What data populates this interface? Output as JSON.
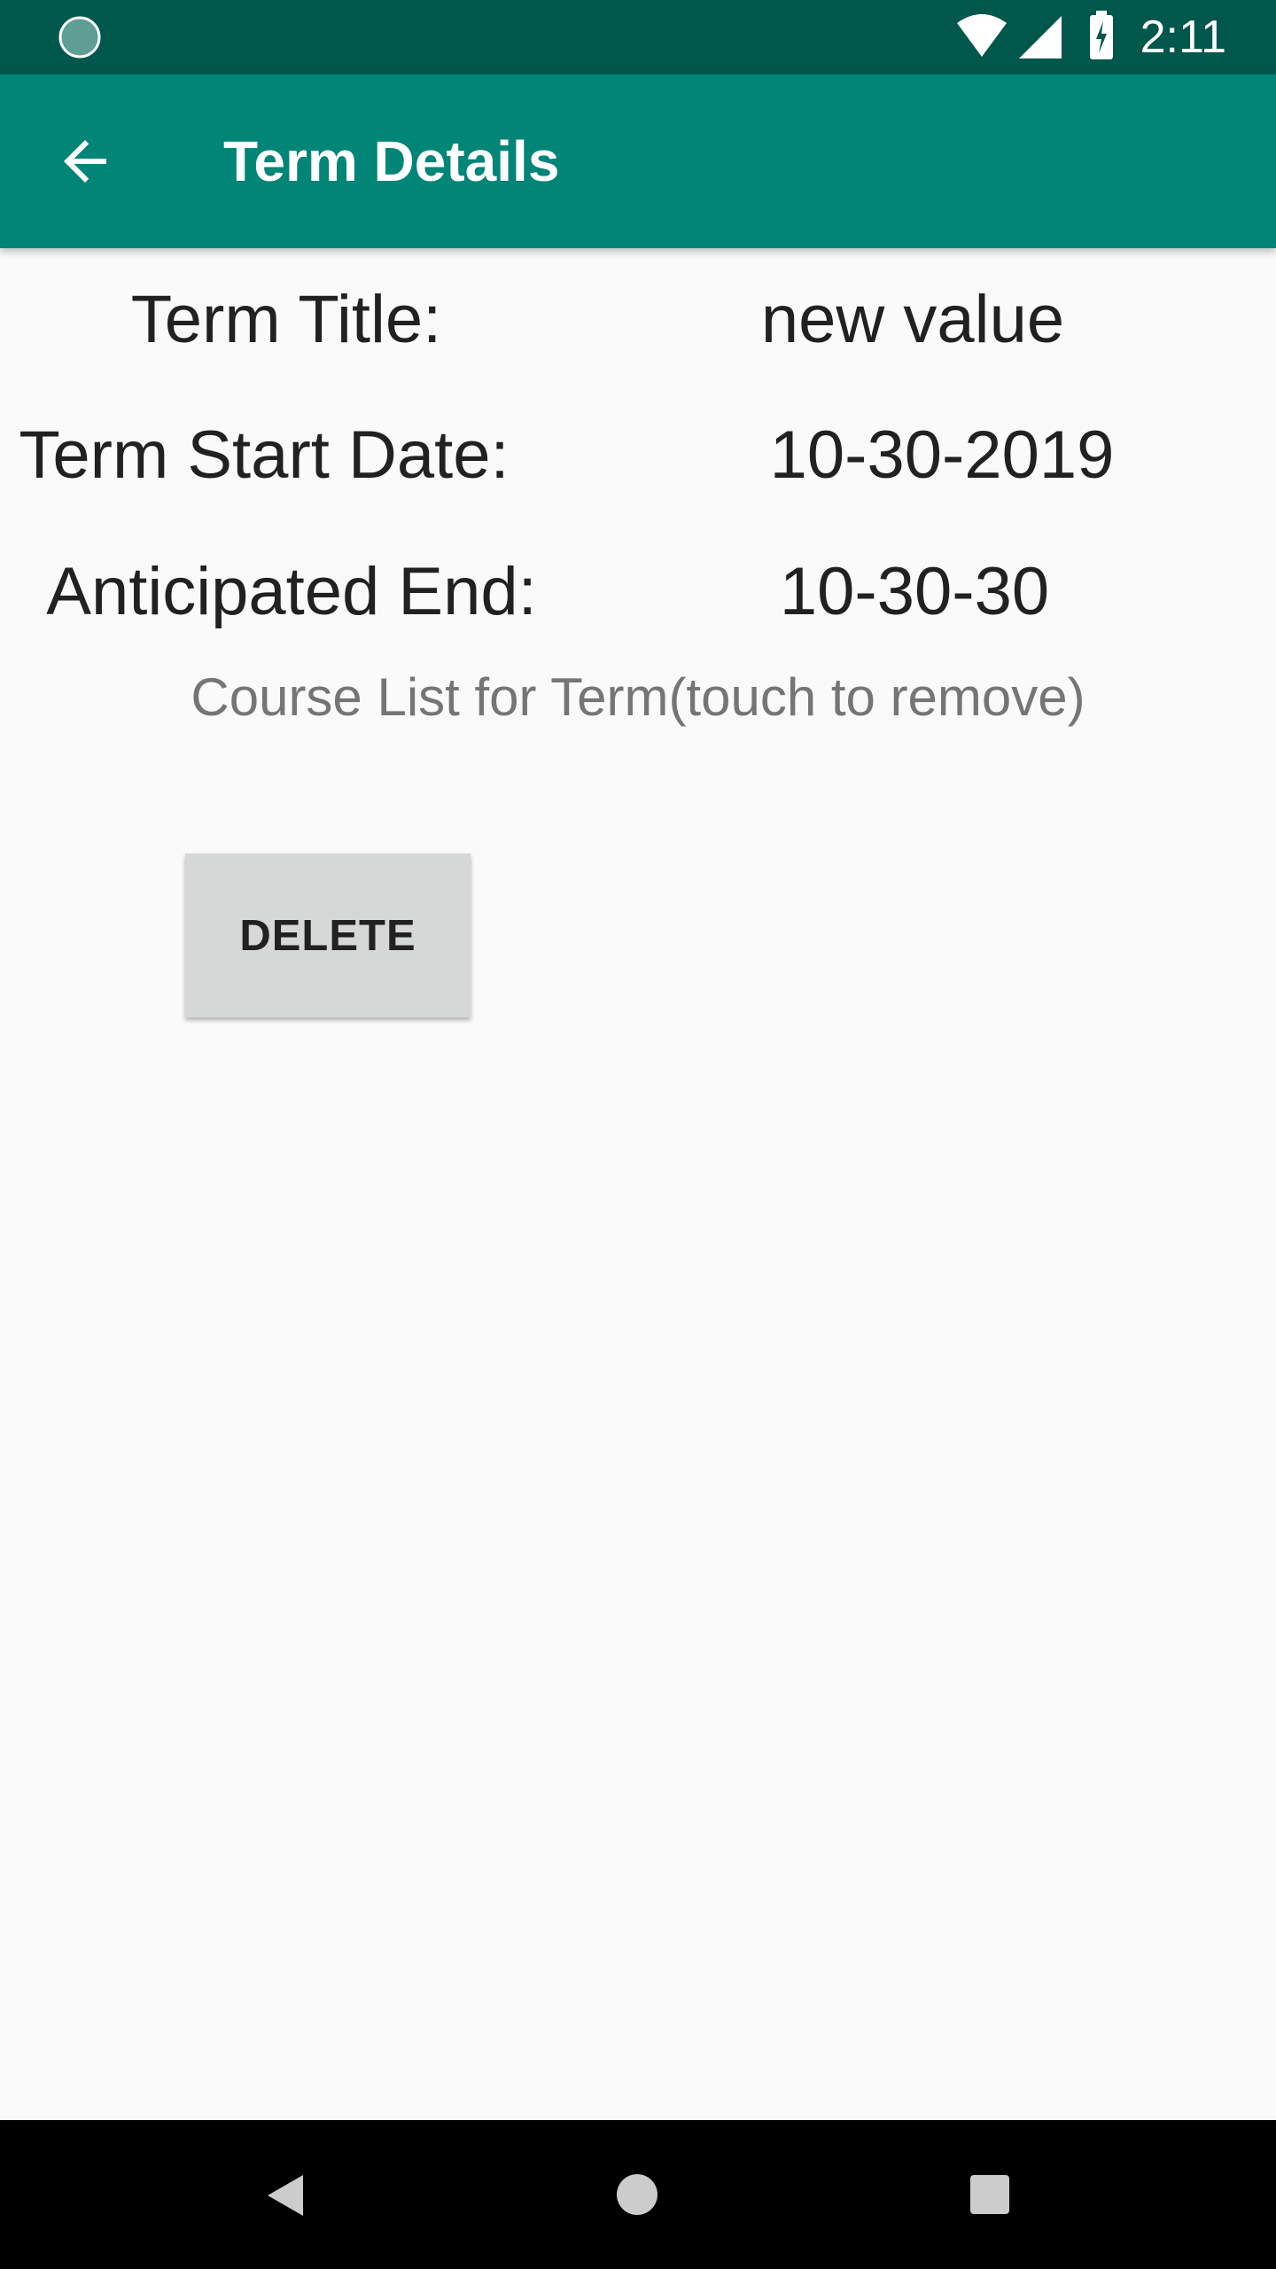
{
  "status_bar": {
    "time": "2:11",
    "icons": [
      "sync-icon",
      "wifi-icon",
      "signal-icon",
      "battery-charging-icon"
    ]
  },
  "toolbar": {
    "title": "Term Details",
    "back_icon": "arrow-back-icon"
  },
  "details": {
    "term_title_label": "Term Title:",
    "term_title_value": "new value",
    "start_date_label": "Term Start Date:",
    "start_date_value": "10-30-2019",
    "end_label": "Anticipated End:",
    "end_value": "10-30-30"
  },
  "course_list_label": "Course List for Term(touch to remove)",
  "delete_button": "DELETE",
  "colors": {
    "primary": "#008577",
    "primary_dark": "#00574b",
    "background": "#fafafa"
  }
}
